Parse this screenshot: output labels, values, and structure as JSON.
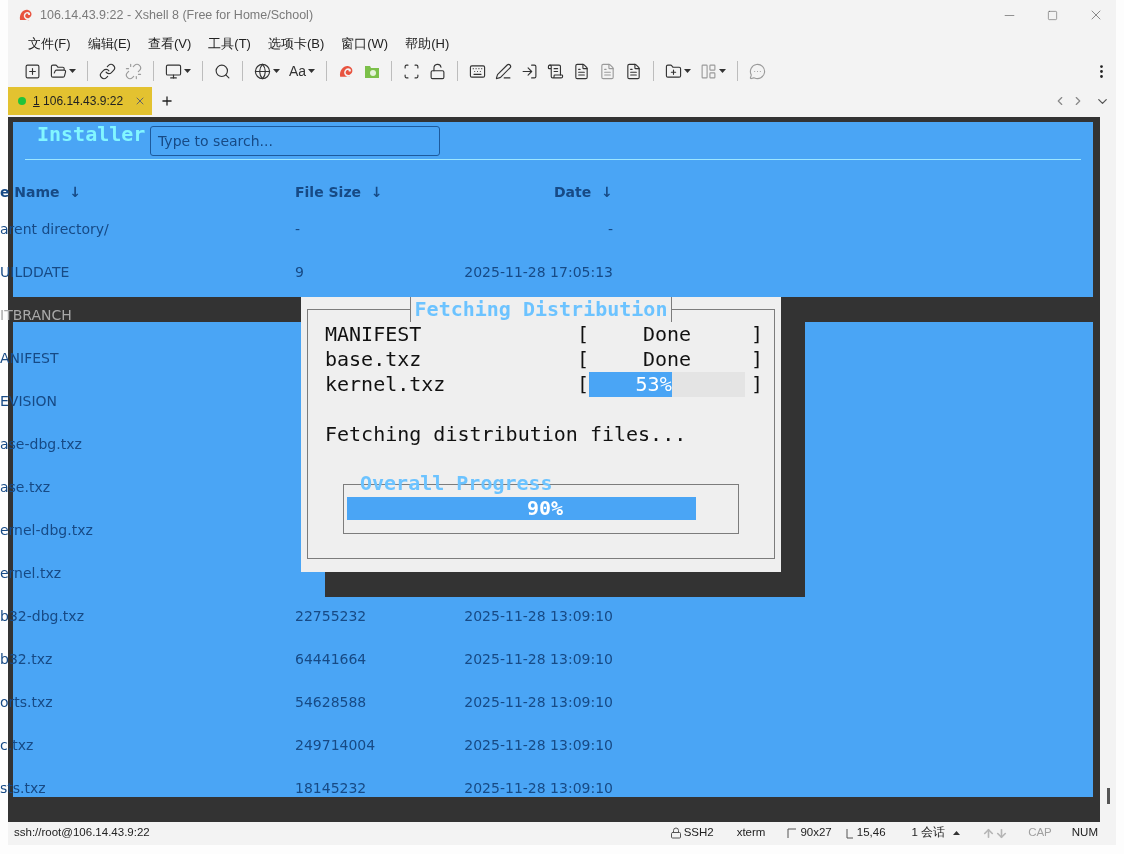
{
  "window": {
    "title": "106.14.43.9:22 - Xshell 8 (Free for Home/School)"
  },
  "menu": [
    "文件(F)",
    "编辑(E)",
    "查看(V)",
    "工具(T)",
    "选项卡(B)",
    "窗口(W)",
    "帮助(H)"
  ],
  "toolbar": {
    "font_label": "Aa"
  },
  "tabs": [
    {
      "number": "1",
      "label": "106.14.43.9:22",
      "selected": true,
      "connected": true
    }
  ],
  "terminal": {
    "backtitle": "Installer",
    "dialog": {
      "title": "Fetching Distribution",
      "files": [
        {
          "kind": "status",
          "name": "MANIFEST",
          "open": "[",
          "status": "Done",
          "close": "]"
        },
        {
          "kind": "status",
          "name": "base.txz",
          "open": "[",
          "status": "Done",
          "close": "]"
        },
        {
          "kind": "progress",
          "name": "kernel.txz",
          "open": "[",
          "level": 0.53,
          "reading": "53%",
          "close": "]"
        }
      ],
      "message": "Fetching distribution files...",
      "overall": {
        "title": "Overall Progress",
        "level": 0.9,
        "reading": "90%"
      }
    }
  },
  "background_page": {
    "search": {
      "placeholder": "Type to search..."
    },
    "columns": [
      {
        "label": "e Name",
        "arrow": "↓"
      },
      {
        "label": "File Size",
        "arrow": "↓"
      },
      {
        "label": "Date",
        "arrow": "↓"
      }
    ],
    "rows": [
      {
        "name": "arent directory/",
        "size": "-",
        "date": "-"
      },
      {
        "name": "UILDDATE",
        "size": "9",
        "date": "2025-11-28 17:05:13"
      },
      {
        "name": "ITBRANCH"
      },
      {
        "name": "ANIFEST"
      },
      {
        "name": "EVISION"
      },
      {
        "name": "ase-dbg.txz"
      },
      {
        "name": "ase.txz"
      },
      {
        "name": "ernel-dbg.txz"
      },
      {
        "name": "ernel.txz"
      },
      {
        "name": "b32-dbg.txz",
        "size": "22755232",
        "date": "2025-11-28 13:09:10"
      },
      {
        "name": "b32.txz",
        "size": "64441664",
        "date": "2025-11-28 13:09:10"
      },
      {
        "name": "orts.txz",
        "size": "54628588",
        "date": "2025-11-28 13:09:10"
      },
      {
        "name": "c.txz",
        "size": "249714004",
        "date": "2025-11-28 13:09:10"
      },
      {
        "name": "sts.txz",
        "size": "18145232",
        "date": "2025-11-28 13:09:10"
      }
    ]
  },
  "status_bar": {
    "address": "ssh://root@106.14.43.9:22",
    "protocol": "SSH2",
    "terminal_type": "xterm",
    "size": "90x27",
    "cursor": "15,46",
    "sessions": "1 会话",
    "indicators": [
      {
        "label": "CAP",
        "on": false
      },
      {
        "label": "NUM",
        "on": true
      }
    ]
  }
}
